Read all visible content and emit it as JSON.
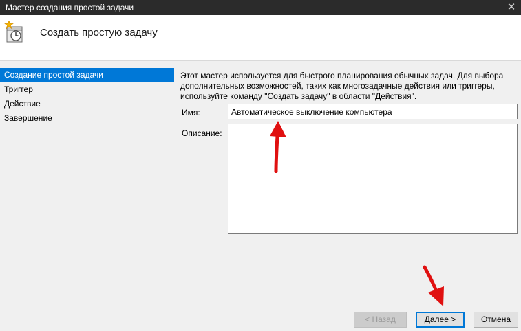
{
  "window": {
    "title": "Мастер создания простой задачи",
    "close_glyph": "✕"
  },
  "header": {
    "icon": "task-scheduler-icon",
    "title": "Создать простую задачу"
  },
  "sidebar": {
    "items": [
      {
        "label": "Создание простой задачи",
        "active": true
      },
      {
        "label": "Триггер",
        "active": false
      },
      {
        "label": "Действие",
        "active": false
      },
      {
        "label": "Завершение",
        "active": false
      }
    ]
  },
  "main": {
    "description_lines": [
      "Этот мастер используется для быстрого планирования обычных задач.  Для выбора",
      "дополнительных возможностей, таких как многозадачные действия или триггеры,",
      "используйте команду \"Создать задачу\" в области \"Действия\"."
    ],
    "name_label": "Имя:",
    "name_value": "Автоматическое выключение компьютера",
    "description_label": "Описание:",
    "description_value": ""
  },
  "buttons": {
    "back": "< Назад",
    "next": "Далее >",
    "cancel": "Отмена"
  },
  "colors": {
    "accent": "#0078d7",
    "annotation_arrow": "#e01010",
    "titlebar": "#2b2b2b"
  }
}
